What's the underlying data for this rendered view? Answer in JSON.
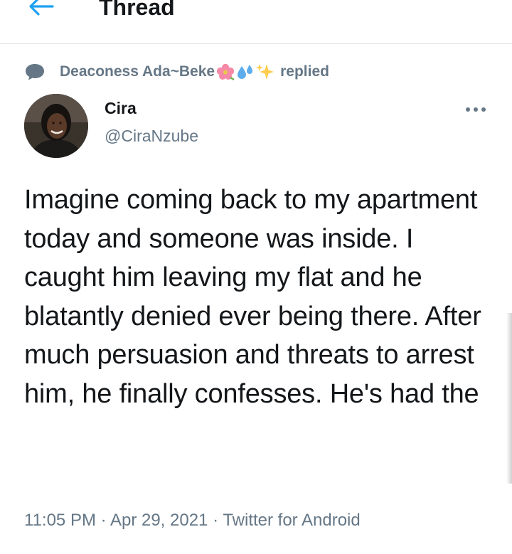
{
  "header": {
    "title": "Thread",
    "back_icon": "arrow-left-icon"
  },
  "social_context": {
    "name": "Deaconess Ada~Beke",
    "emojis": [
      "hibiscus",
      "sweat-droplets",
      "sparkles"
    ],
    "verb": "replied"
  },
  "tweet": {
    "display_name": "Cira",
    "handle": "@CiraNzube",
    "text": "Imagine coming back to my apartment today and someone was inside. I caught him leaving my flat and he blatantly denied ever being there. After much persuasion and threats to arrest him, he finally confesses. He's had the",
    "time": "11:05 PM",
    "date": "Apr 29, 2021",
    "source": "Twitter for Android",
    "separator": " · "
  },
  "colors": {
    "accent": "#1da1f2",
    "secondary_text": "#657786",
    "primary_text": "#14171a"
  }
}
